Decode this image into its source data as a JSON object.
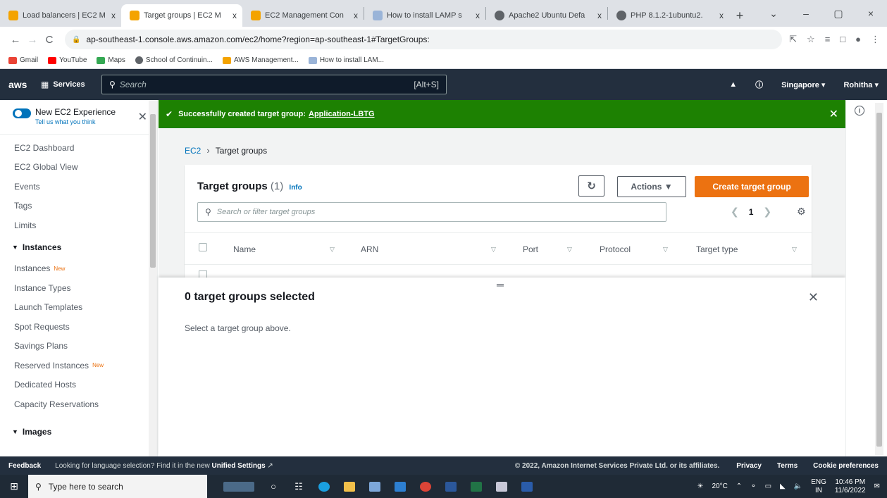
{
  "browser": {
    "tabs": [
      {
        "title": "Load balancers | EC2 M",
        "color": "#f4a300",
        "active": false
      },
      {
        "title": "Target groups | EC2 M",
        "color": "#f4a300",
        "active": true
      },
      {
        "title": "EC2 Management Con",
        "color": "#f4a300",
        "active": false
      },
      {
        "title": "How to install LAMP s",
        "color": "#9ab4d8",
        "active": false
      },
      {
        "title": "Apache2 Ubuntu Defa",
        "color": "#5f6368",
        "active": false
      },
      {
        "title": "PHP 8.1.2-1ubuntu2.",
        "color": "#5f6368",
        "active": false
      }
    ],
    "tab_close": "x",
    "new_tab": "+",
    "window_controls": {
      "minimize": "–",
      "restore": "▢",
      "close": "×",
      "dropdown": "⌄"
    },
    "url": "ap-southeast-1.console.aws.amazon.com/ec2/home?region=ap-southeast-1#TargetGroups:",
    "nav": {
      "back": "←",
      "forward": "→",
      "reload": "C"
    },
    "bookmarks": [
      {
        "label": "Gmail",
        "color": "#ea4335"
      },
      {
        "label": "YouTube",
        "color": "#ff0000"
      },
      {
        "label": "Maps",
        "color": "#34a853"
      },
      {
        "label": "School of Continuin...",
        "color": "#5f6368"
      },
      {
        "label": "AWS Management...",
        "color": "#f4a300"
      },
      {
        "label": "How to install LAM...",
        "color": "#9ab4d8"
      }
    ]
  },
  "aws_nav": {
    "logo": "aws",
    "services_label": "Services",
    "search_placeholder": "Search",
    "search_shortcut": "[Alt+S]",
    "region": "Singapore ▾",
    "user": "Rohitha ▾"
  },
  "sidebar": {
    "new_experience_title": "New EC2 Experience",
    "new_experience_sub": "Tell us what you think",
    "items": [
      {
        "label": "EC2 Dashboard"
      },
      {
        "label": "EC2 Global View"
      },
      {
        "label": "Events"
      },
      {
        "label": "Tags"
      },
      {
        "label": "Limits"
      }
    ],
    "instances_head": "Instances",
    "instances_items": [
      {
        "label": "Instances",
        "badge": "New"
      },
      {
        "label": "Instance Types"
      },
      {
        "label": "Launch Templates"
      },
      {
        "label": "Spot Requests"
      },
      {
        "label": "Savings Plans"
      },
      {
        "label": "Reserved Instances",
        "badge": "New"
      },
      {
        "label": "Dedicated Hosts"
      },
      {
        "label": "Capacity Reservations"
      }
    ],
    "images_head": "Images"
  },
  "flash": {
    "text": "Successfully created target group:",
    "link": "Application-LBTG"
  },
  "breadcrumb": {
    "root": "EC2",
    "current": "Target groups"
  },
  "panel": {
    "title": "Target groups",
    "count": "(1)",
    "info": "Info",
    "actions_label": "Actions ▼",
    "create_label": "Create target group",
    "filter_placeholder": "Search or filter target groups",
    "page": "1",
    "columns": [
      "Name",
      "ARN",
      "Port",
      "Protocol",
      "Target type"
    ]
  },
  "split_panel": {
    "title": "0 target groups selected",
    "message": "Select a target group above."
  },
  "footer": {
    "feedback": "Feedback",
    "lang_text": "Looking for language selection? Find it in the new",
    "lang_link": "Unified Settings",
    "copyright": "© 2022, Amazon Internet Services Private Ltd. or its affiliates.",
    "links": [
      "Privacy",
      "Terms",
      "Cookie preferences"
    ]
  },
  "taskbar": {
    "search_placeholder": "Type here to search",
    "temperature": "20°C",
    "lang": "ENG",
    "region": "IN",
    "time": "10:46 PM",
    "date": "11/6/2022"
  }
}
